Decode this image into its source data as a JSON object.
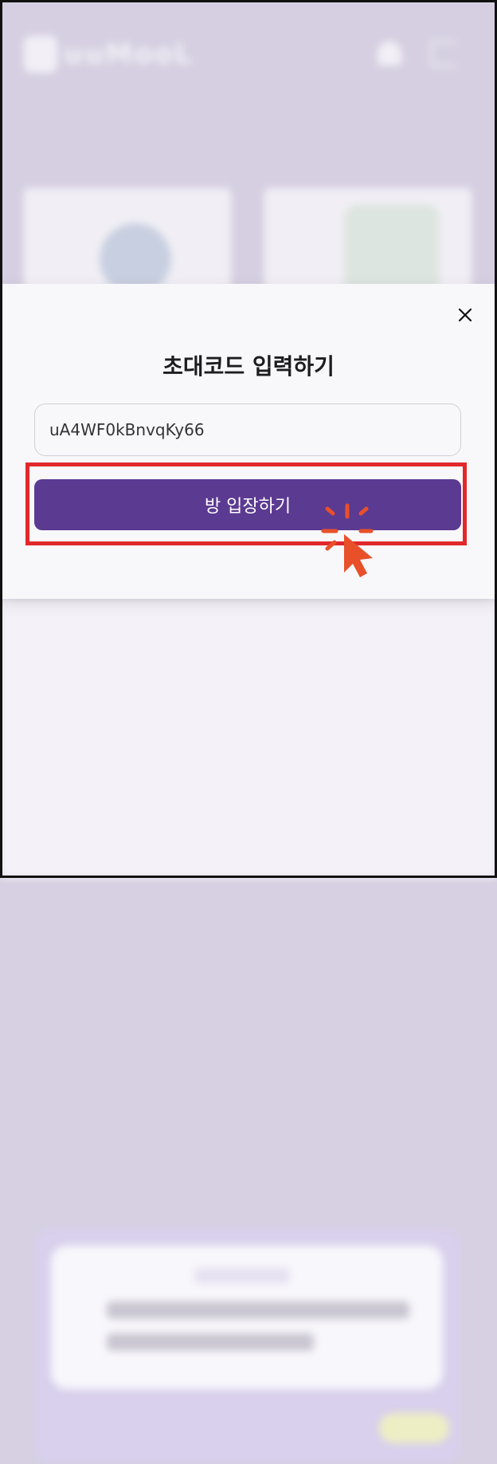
{
  "background_app": {
    "logo_text": "uuMooL"
  },
  "modal": {
    "title": "초대코드 입력하기",
    "code_value": "uA4WF0kBnvqKy66",
    "enter_button_label": "방 입장하기",
    "close_icon": "close-icon"
  },
  "colors": {
    "primary": "#5b3a92",
    "highlight": "#e1282b",
    "cursor": "#e8502a",
    "backdrop": "#d6d0e2"
  }
}
